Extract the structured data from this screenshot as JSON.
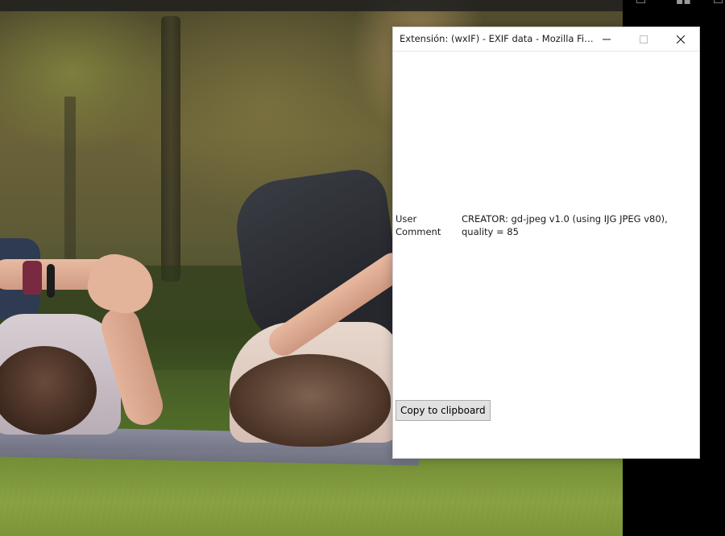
{
  "window": {
    "title": "Extensión: (wxIF) - EXIF data - Mozilla Firef...",
    "controls": {
      "minimize_icon": "minimize-icon",
      "maximize_icon": "maximize-icon",
      "close_icon": "close-icon"
    }
  },
  "exif": {
    "rows": [
      {
        "key": "User Comment",
        "value": "CREATOR: gd-jpeg v1.0 (using IJG JPEG v80), quality = 85"
      }
    ]
  },
  "actions": {
    "copy_label": "Copy to clipboard"
  },
  "colors": {
    "window_bg": "#ffffff",
    "button_bg": "#e1e1e1",
    "button_border": "#adadad",
    "desktop_right": "#000000"
  }
}
